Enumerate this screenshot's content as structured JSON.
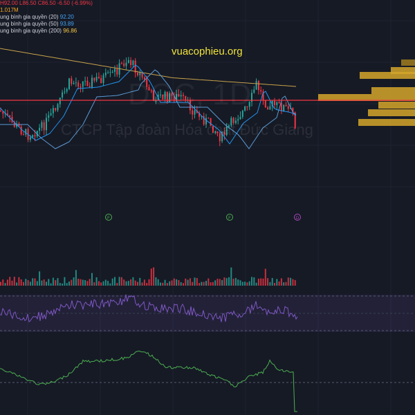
{
  "ohlc": {
    "h": "H92.00",
    "l": "L86.50",
    "c": "C86.50",
    "chg": "-6.50 (-6.99%)"
  },
  "volume": "1.017M",
  "ma": [
    {
      "label": "ung bình gia quyền (20)",
      "value": "92.20"
    },
    {
      "label": "ung bình gia quyền (50)",
      "value": "93.89"
    },
    {
      "label": "ung bình gia quyền (200)",
      "value": "96.86"
    }
  ],
  "brand": "vuacophieu.org",
  "watermark": {
    "symbol": "DGC, 1D",
    "company": "CTCP Tập đoàn Hóa chất Đức Giang"
  },
  "markers": [
    "F",
    "F",
    "D"
  ],
  "colors": {
    "up": "#26a69a",
    "down": "#f23645",
    "ma20": "#2196f3",
    "ma50": "#5b9bd5",
    "ma200": "#c8a24a",
    "rsi": "#7e57c2",
    "bottom": "#4caf50"
  }
}
